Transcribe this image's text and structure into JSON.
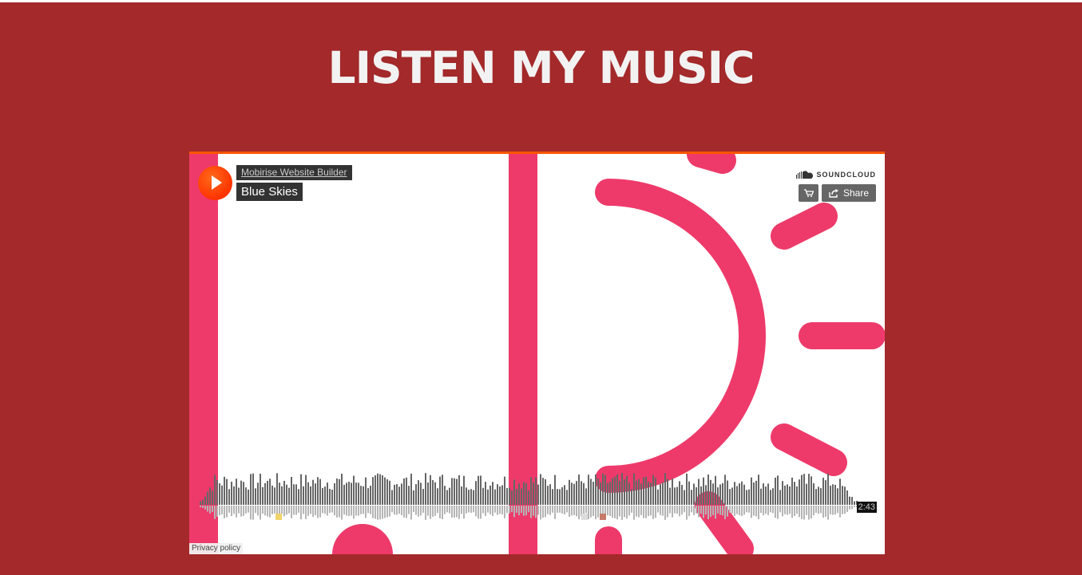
{
  "section": {
    "title": "LISTEN MY MUSIC"
  },
  "player": {
    "uploader": "Mobirise Website Builder",
    "track_title": "Blue Skies",
    "brand": "SOUNDCLOUD",
    "share_label": "Share",
    "duration": "2:43",
    "privacy": "Privacy policy",
    "play_icon": "play-icon",
    "cart_icon": "cart-icon",
    "share_icon": "share-icon",
    "logo_icon": "soundcloud-cloud-icon"
  },
  "colors": {
    "section_bg": "#a3292a",
    "title": "#f2f2f2",
    "artwork_pink": "#ee3a6a",
    "accent": "#ff5500",
    "played_wave": "#666666",
    "unplayed_wave": "#b5b5b5"
  }
}
